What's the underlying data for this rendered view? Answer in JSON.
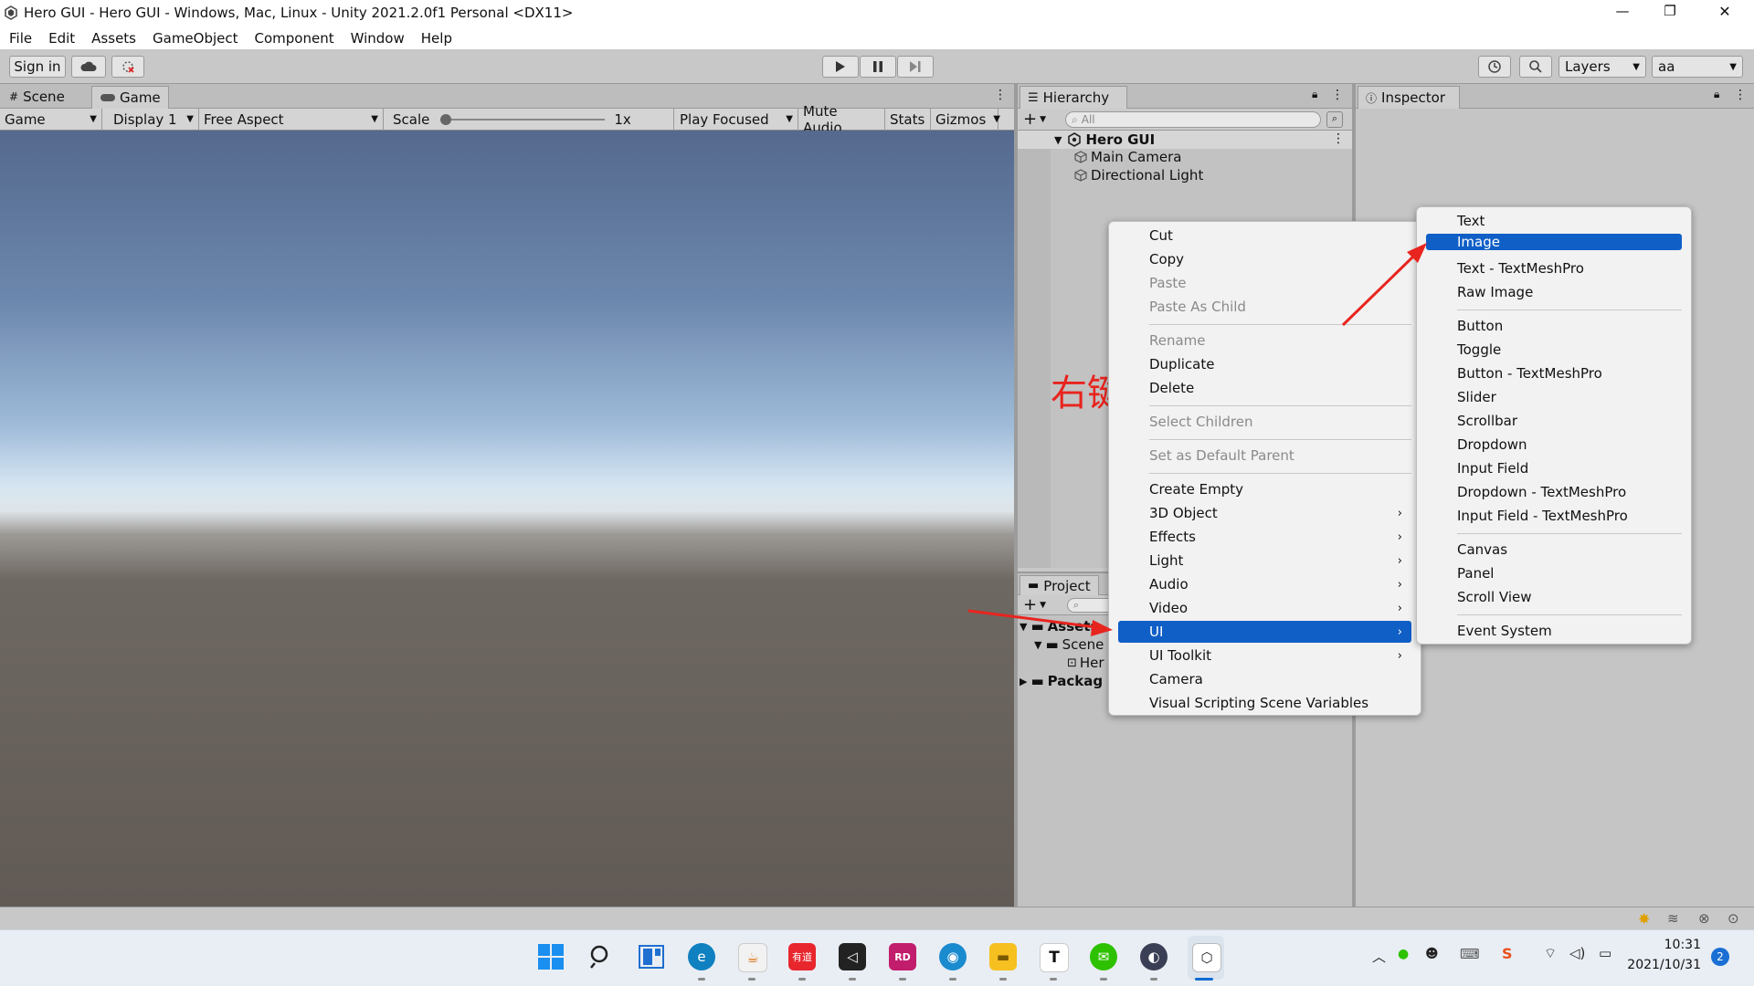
{
  "window": {
    "title": "Hero GUI - Hero GUI - Windows, Mac, Linux - Unity 2021.2.0f1 Personal <DX11>",
    "controls": [
      "—",
      "❐",
      "✕"
    ]
  },
  "menubar": [
    "File",
    "Edit",
    "Assets",
    "GameObject",
    "Component",
    "Window",
    "Help"
  ],
  "toolbar": {
    "sign_in": "Sign in",
    "layers": "Layers",
    "layout": "aa"
  },
  "tabs_left": [
    "Scene",
    "Game"
  ],
  "game_bar": {
    "mode": "Game",
    "display": "Display 1",
    "aspect": "Free Aspect",
    "scale_label": "Scale",
    "scale_value": "1x",
    "play_focused": "Play Focused",
    "mute_audio": "Mute Audio",
    "stats": "Stats",
    "gizmos": "Gizmos"
  },
  "hierarchy": {
    "tab": "Hierarchy",
    "search_placeholder": "All",
    "scene": "Hero GUI",
    "items": [
      "Main Camera",
      "Directional Light"
    ]
  },
  "inspector": {
    "tab": "Inspector"
  },
  "project": {
    "tab": "Project",
    "tree": [
      "Assets",
      "Scene",
      "Her",
      "Packag"
    ]
  },
  "annotation": {
    "text": "右键",
    "color": "#e8241e"
  },
  "context_menu": {
    "items": [
      {
        "label": "Cut"
      },
      {
        "label": "Copy"
      },
      {
        "label": "Paste",
        "disabled": true
      },
      {
        "label": "Paste As Child",
        "disabled": true
      },
      {
        "label": "Rename",
        "disabled": true
      },
      {
        "label": "Duplicate"
      },
      {
        "label": "Delete"
      },
      {
        "label": "Select Children",
        "disabled": true
      },
      {
        "label": "Set as Default Parent",
        "disabled": true
      },
      {
        "label": "Create Empty"
      },
      {
        "label": "3D Object",
        "submenu": true
      },
      {
        "label": "Effects",
        "submenu": true
      },
      {
        "label": "Light",
        "submenu": true
      },
      {
        "label": "Audio",
        "submenu": true
      },
      {
        "label": "Video",
        "submenu": true
      },
      {
        "label": "UI",
        "submenu": true,
        "selected": true
      },
      {
        "label": "UI Toolkit",
        "submenu": true
      },
      {
        "label": "Camera"
      },
      {
        "label": "Visual Scripting Scene Variables"
      }
    ]
  },
  "ui_submenu": {
    "items": [
      {
        "label": "Text"
      },
      {
        "label": "Image",
        "selected": true
      },
      {
        "label": "Text - TextMeshPro"
      },
      {
        "label": "Raw Image"
      },
      {
        "label": "Button"
      },
      {
        "label": "Toggle"
      },
      {
        "label": "Button - TextMeshPro"
      },
      {
        "label": "Slider"
      },
      {
        "label": "Scrollbar"
      },
      {
        "label": "Dropdown"
      },
      {
        "label": "Input Field"
      },
      {
        "label": "Dropdown - TextMeshPro"
      },
      {
        "label": "Input Field - TextMeshPro"
      },
      {
        "label": "Canvas"
      },
      {
        "label": "Panel"
      },
      {
        "label": "Scroll View"
      },
      {
        "label": "Event System"
      }
    ]
  },
  "taskbar": {
    "time": "10:31",
    "date": "2021/10/31",
    "notifications": "2",
    "youdao": "有道",
    "rider": "RD",
    "typora": "T"
  },
  "colors": {
    "selection": "#0f5fc7",
    "accent_red": "#e8241e"
  }
}
